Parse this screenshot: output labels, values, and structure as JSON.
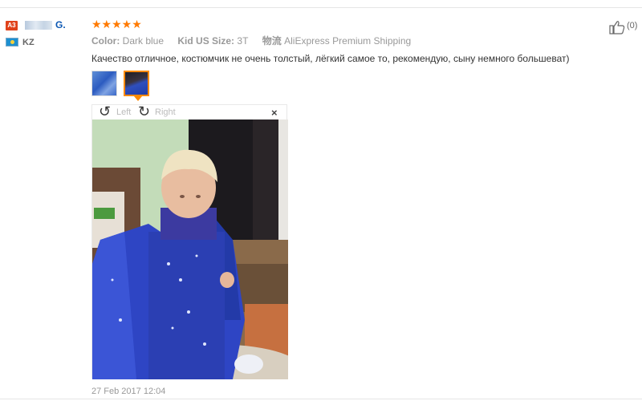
{
  "review": {
    "badge": "A3",
    "user_name": "G.",
    "country": "KZ",
    "stars": "★★★★★",
    "attributes": {
      "color_label": "Color:",
      "color_value": "Dark blue",
      "size_label": "Kid US Size:",
      "size_value": "3T",
      "shipping_label": "物流",
      "shipping_value": "AliExpress Premium Shipping"
    },
    "text": "Качество отличное, костюмчик не очень толстый, лёгкий самое то, рекомендую, сыну немного большеват)",
    "date": "27 Feb 2017 12:04",
    "helpful_count": "(0)"
  },
  "viewer": {
    "rotate_left_label": "Left",
    "rotate_right_label": "Right",
    "close_glyph": "×",
    "rotate_left_glyph": "↺",
    "rotate_right_glyph": "↻"
  },
  "colors": {
    "accent_star": "#ff7a00",
    "name_link": "#0b57b3",
    "badge": "#e0421a",
    "thumb_selected_border": "#ff8a00"
  }
}
